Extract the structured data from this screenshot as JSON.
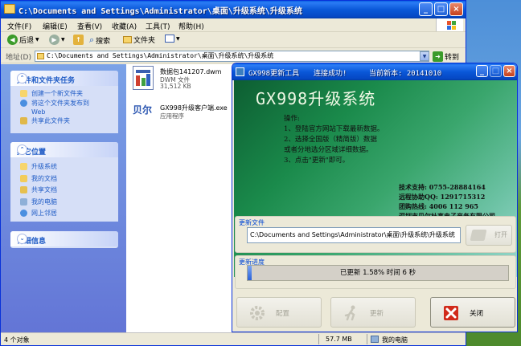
{
  "explorer": {
    "title": "C:\\Documents and Settings\\Administrator\\桌面\\升级系统\\升级系统",
    "menu": [
      "文件(F)",
      "编辑(E)",
      "查看(V)",
      "收藏(A)",
      "工具(T)",
      "帮助(H)"
    ],
    "toolbar": {
      "back": "后退",
      "search": "搜索",
      "folders": "文件夹"
    },
    "address": {
      "label": "地址(D)",
      "value": "C:\\Documents and Settings\\Administrator\\桌面\\升级系统\\升级系统",
      "go": "转到"
    },
    "tasks_panel": {
      "title": "文件和文件夹任务",
      "items": [
        "创建一个新文件夹",
        "将这个文件夹发布到",
        "Web",
        "共享此文件夹"
      ]
    },
    "places_panel": {
      "title": "其它位置",
      "items": [
        "升级系统",
        "我的文档",
        "共享文档",
        "我的电脑",
        "网上邻居"
      ]
    },
    "details_panel": {
      "title": "详细信息"
    },
    "files": [
      {
        "name": "数据包141207.dwm",
        "type": "DWM 文件",
        "size": "31,512 KB"
      },
      {
        "name": "GX998升级客户端.exe",
        "type": "应用程序",
        "logo": "贝尔"
      }
    ],
    "status": {
      "count": "4 个对象",
      "size": "57.7 MB",
      "location": "我的电脑"
    }
  },
  "updater": {
    "title_app": "GX998更新工具",
    "title_status": "连接成功!",
    "title_version": "当前新本: 20141010",
    "heading": "GX998升级系统",
    "steps": [
      "操作:",
      "1、登陆官方网站下载最新数据。",
      "2、选择全国版（精简版）数据",
      "    或者分地选分区域详细数据。",
      "3、点击\"更新\"即可。"
    ],
    "contact": [
      "技术支持: 0755-28884164",
      "远程协助QQ: 1291715312",
      "团购热线: 4006 112 965",
      "深圳市贝尔杜高电子商务有限公司"
    ],
    "file_group": {
      "label": "更新文件",
      "path": "C:\\Documents and Settings\\Administrator\\桌面\\升级系统\\升级系统",
      "open_button": "打开"
    },
    "progress_group": {
      "label": "更新进度",
      "text": "已更新 1.58%  时间 6 秒",
      "fraction": 0.0158
    },
    "buttons": {
      "config": "配置",
      "update": "更新",
      "close": "关闭"
    }
  }
}
